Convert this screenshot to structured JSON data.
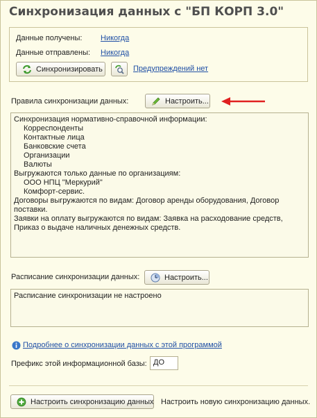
{
  "window": {
    "title": "Синхронизация данных с \"БП КОРП 3.0\""
  },
  "status": {
    "received_label": "Данные получены:",
    "received_value": "Никогда",
    "sent_label": "Данные отправлены:",
    "sent_value": "Никогда",
    "sync_button": "Синхронизировать",
    "warnings_link": "Предупреждений нет"
  },
  "rules": {
    "label": "Правила синхронизации данных:",
    "configure_button": "Настроить...",
    "lines": [
      "Синхронизация нормативно-справочной информации:",
      "Корреспонденты",
      "Контактные лица",
      "Банковские счета",
      "Организации",
      "Валюты",
      "Выгружаются только данные по организациям:",
      "ООО НПЦ \"Меркурий\"",
      "Комфорт-сервис.",
      "Договоры выгружаются по видам: Договор аренды оборудования, Договор",
      "поставки.",
      "Заявки на оплату выгружаются по видам: Заявка на расходование средств,",
      "Приказ о выдаче наличных денежных средств."
    ]
  },
  "schedule": {
    "label": "Расписание синхронизации данных:",
    "configure_button": "Настроить...",
    "text": "Расписание синхронизации не настроено"
  },
  "more_link": "Подробнее о синхронизации данных с этой программой",
  "prefix": {
    "label": "Префикс этой информационной базы:",
    "value": "ДО"
  },
  "footer": {
    "setup_button": "Настроить синхронизацию данных",
    "hint": "Настроить новую синхронизацию данных."
  },
  "colors": {
    "arrow": "#e02020",
    "title": "#4f4f4f",
    "link": "#1f4fa5",
    "background": "#fdfce9"
  }
}
